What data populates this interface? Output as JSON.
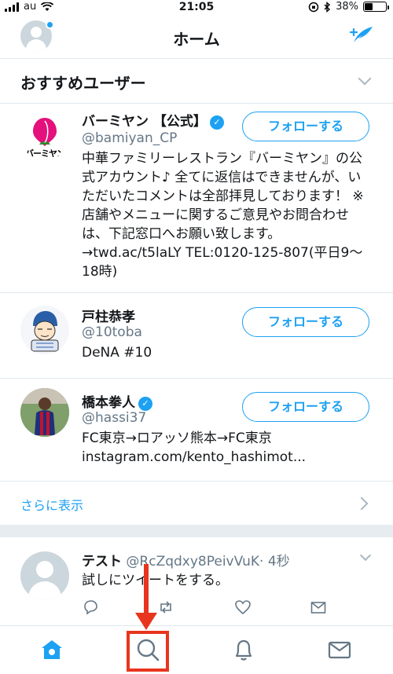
{
  "status_bar": {
    "carrier": "au",
    "time": "21:05",
    "battery": "38%",
    "battery_level": 0.38
  },
  "header": {
    "title": "ホーム"
  },
  "recommended": {
    "heading": "おすすめユーザー",
    "follow_label": "フォローする",
    "users": [
      {
        "name": "バーミヤン 【公式】",
        "verified": true,
        "handle": "@bamiyan_CP",
        "bio": "中華ファミリーレストラン『バーミヤン』の公式アカウント♪ 全てに返信はできませんが、いただいたコメントは全部拝見しております！ ※店舗やメニューに関するご意見やお問合わせは、下記窓口へお願い致します。→twd.ac/t5laLY TEL:0120-125-807(平日9〜18時)",
        "avatar_text": "バーミヤン"
      },
      {
        "name": "戸柱恭孝",
        "verified": false,
        "handle": "@10toba",
        "bio": "DeNA #10"
      },
      {
        "name": "橋本拳人",
        "verified": true,
        "handle": "@hassi37",
        "bio": "FC東京→ロアッソ熊本→FC東京\ninstagram.com/kento_hashimot..."
      }
    ],
    "show_more": "さらに表示"
  },
  "tweet": {
    "name": "テスト",
    "handle": "@RcZqdxy8PeivVuK",
    "time": "· 4秒",
    "text": "試しにツイートをする。"
  },
  "colors": {
    "accent": "#1da1f2",
    "annotation": "#e8351d"
  },
  "icons": [
    "home-icon",
    "search-icon",
    "bell-icon",
    "mail-icon",
    "compose-icon",
    "reply-icon",
    "retweet-icon",
    "like-icon",
    "share-icon"
  ]
}
